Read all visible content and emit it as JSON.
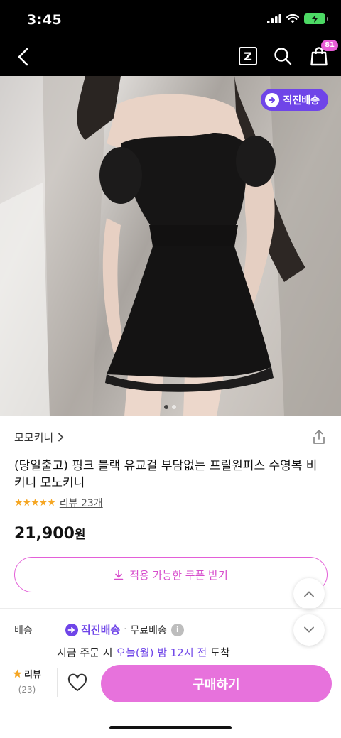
{
  "status_bar": {
    "time": "3:45"
  },
  "nav": {
    "cart_count": "81",
    "zigzag_label": "Z"
  },
  "hero": {
    "shipping_chip": "직진배송",
    "image_count": 2,
    "active_index": 0
  },
  "product": {
    "store_name": "모모키니",
    "title": "(당일출고) 핑크 블랙 유교걸 부담없는 프릴원피스 수영복 비키니 모노키니",
    "rating": 4.5,
    "review_link": "리뷰 23개",
    "price": "21,900",
    "currency": "원",
    "coupon_label": "적용 가능한 쿠폰 받기"
  },
  "shipping": {
    "label": "배송",
    "brand": "직진배송",
    "fee": "무료배송",
    "eta_prefix": "지금 주문 시",
    "eta_highlight": "오늘(월) 밤 12시 전",
    "eta_suffix": "도착"
  },
  "bottom_bar": {
    "review_label": "리뷰",
    "review_count": "(23)",
    "buy_label": "구매하기"
  },
  "colors": {
    "accent_purple": "#6f45e8",
    "accent_pink": "#e772dc",
    "star": "#f5a623"
  }
}
